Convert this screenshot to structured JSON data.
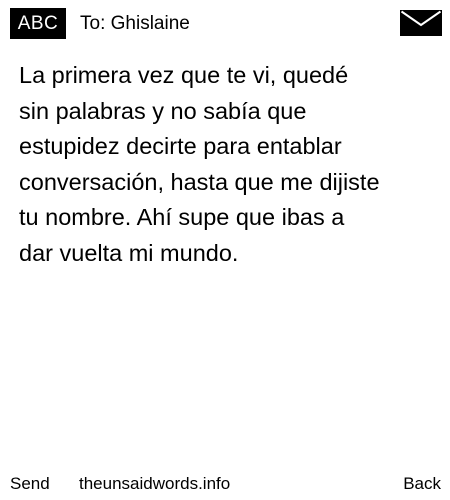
{
  "header": {
    "mode_label": "ABC",
    "recipient_label": "To: Ghislaine",
    "message_icon": "envelope-icon"
  },
  "message": {
    "body": "La primera vez que te vi, quedé\nsin palabras y no sabía que\nestupidez decirte para entablar\nconversación, hasta que me dijiste\ntu nombre. Ahí supe que ibas a\ndar vuelta mi mundo."
  },
  "footer": {
    "send_label": "Send",
    "site_label": "theunsaidwords.info",
    "back_label": "Back"
  },
  "colors": {
    "background": "#ffffff",
    "text": "#000000",
    "badge_background": "#000000",
    "badge_text": "#ffffff"
  }
}
